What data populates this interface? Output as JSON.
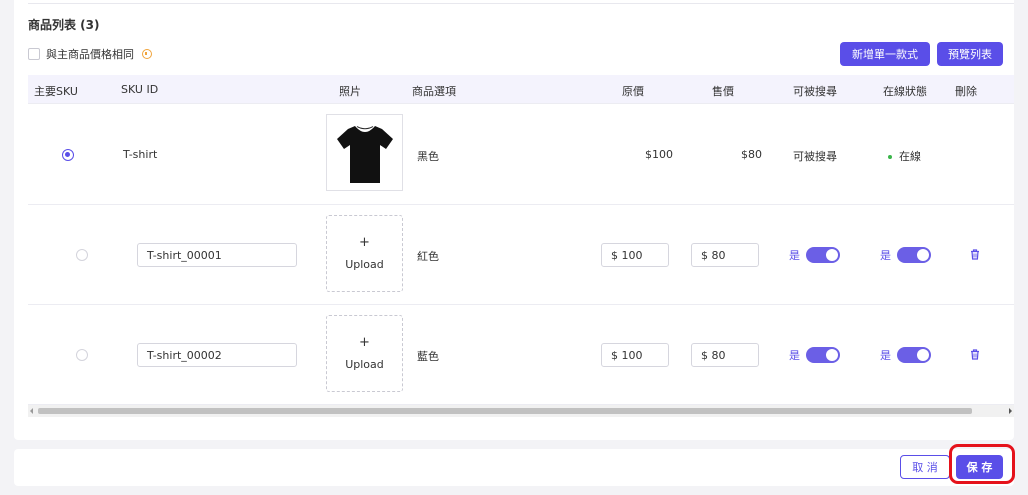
{
  "section": {
    "title": "商品列表 (3)",
    "same_price_label": "與主商品價格相同"
  },
  "toolbar": {
    "add_label": "新增單一款式",
    "preview_label": "預覽列表"
  },
  "table": {
    "headers": [
      "主要SKU",
      "SKU ID",
      "照片",
      "商品選項",
      "原價",
      "售價",
      "可被搜尋",
      "在線狀態",
      "刪除"
    ],
    "rows": [
      {
        "primary": true,
        "sku": "T-shirt",
        "option": "黑色",
        "original_price": "$100",
        "sale_price": "$80",
        "searchable": "可被搜尋",
        "status": "在線"
      },
      {
        "primary": false,
        "sku": "T-shirt_00001",
        "upload_plus": "+",
        "upload_label": "Upload",
        "option": "紅色",
        "original_price": "$ 100",
        "sale_price": "$ 80",
        "searchable_label": "是",
        "searchable_on": true,
        "status_label": "是",
        "status_on": true
      },
      {
        "primary": false,
        "sku": "T-shirt_00002",
        "upload_plus": "+",
        "upload_label": "Upload",
        "option": "藍色",
        "original_price": "$ 100",
        "sale_price": "$ 80",
        "searchable_label": "是",
        "searchable_on": true,
        "status_label": "是",
        "status_on": true
      }
    ]
  },
  "footer": {
    "cancel_label": "取 消",
    "save_label": "保 存"
  },
  "colors": {
    "accent": "#5a4ee8",
    "status_online": "#3ab54a",
    "highlight": "#e5121b"
  }
}
